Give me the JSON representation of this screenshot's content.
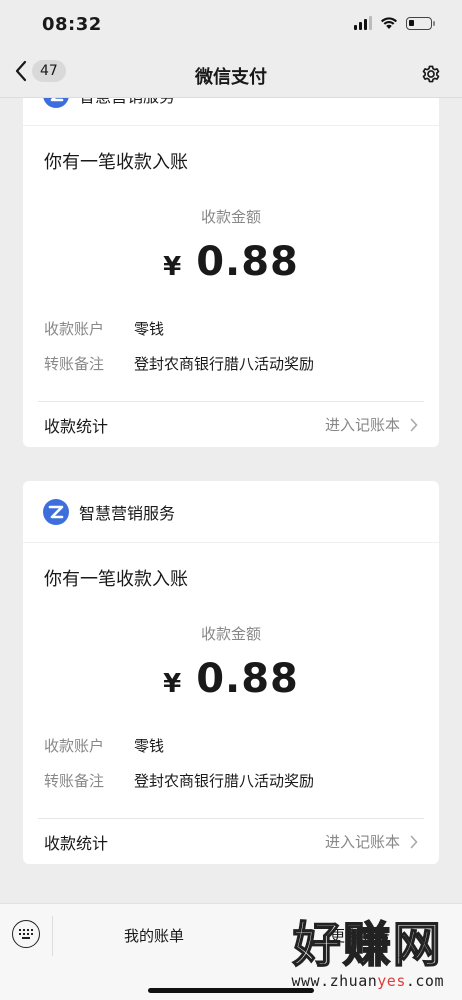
{
  "status_bar": {
    "time": "08:32"
  },
  "nav": {
    "back_count": "47",
    "title": "微信支付"
  },
  "brand_color": "#3d6fdc",
  "cards": [
    {
      "brand": "智慧营销服务",
      "title": "你有一笔收款入账",
      "amount_label": "收款金额",
      "currency": "¥",
      "amount": "0.88",
      "account_label": "收款账户",
      "account_value": "零钱",
      "remark_label": "转账备注",
      "remark_value": "登封农商银行腊八活动奖励",
      "footer_left": "收款统计",
      "footer_right": "进入记账本"
    },
    {
      "brand": "智慧营销服务",
      "title": "你有一笔收款入账",
      "amount_label": "收款金额",
      "currency": "¥",
      "amount": "0.88",
      "account_label": "收款账户",
      "account_value": "零钱",
      "remark_label": "转账备注",
      "remark_value": "登封农商银行腊八活动奖励",
      "footer_left": "收款统计",
      "footer_right": "进入记账本"
    }
  ],
  "bottom_menu": {
    "item1": "我的账单",
    "item2": "更多服务"
  },
  "watermark": {
    "big": "好赚网",
    "small_pre": "www.zhuan",
    "small_hl": "yes",
    "small_post": ".com"
  }
}
